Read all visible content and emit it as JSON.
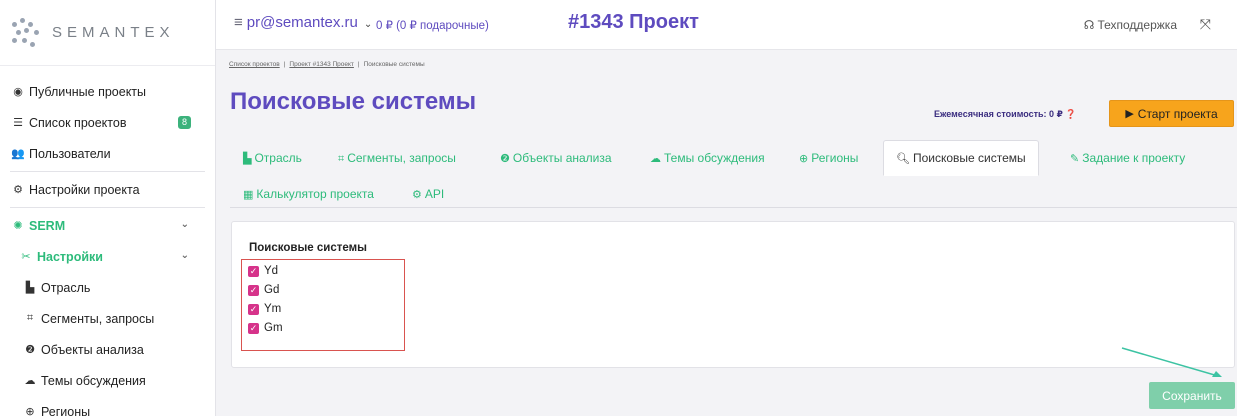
{
  "brand": {
    "logo_text": "SEMANTEX"
  },
  "sidebar": {
    "items": [
      {
        "icon": "eye-icon",
        "label": "Публичные проекты"
      },
      {
        "icon": "list-icon",
        "label": "Список проектов",
        "badge": "8"
      },
      {
        "icon": "users-icon",
        "label": "Пользователи"
      },
      {
        "icon": "settings-icon",
        "label": "Настройки проекта"
      },
      {
        "icon": "serm-icon",
        "label": "SERM"
      },
      {
        "icon": "tools-icon",
        "label": "Настройки"
      },
      {
        "icon": "industry-icon",
        "label": "Отрасль"
      },
      {
        "icon": "segments-icon",
        "label": "Сегменты, запросы"
      },
      {
        "icon": "objects-icon",
        "label": "Объекты анализа"
      },
      {
        "icon": "discussion-icon",
        "label": "Темы обсуждения"
      },
      {
        "icon": "globe-icon",
        "label": "Регионы"
      }
    ]
  },
  "topbar": {
    "user": "pr@semantex.ru",
    "balance": "0 ₽ (0 ₽ подарочные)",
    "project_title": "#1343 Проект",
    "support": "Техподдержка"
  },
  "breadcrumb": {
    "items": [
      "Список проектов",
      "Проект #1343 Проект",
      "Поисковые системы"
    ]
  },
  "page": {
    "title": "Поисковые системы",
    "monthly_cost": "Ежемесячная стоимость: 0 ₽",
    "start_button": "Старт проекта"
  },
  "tabs": [
    {
      "icon": "industry-icon",
      "label": "Отрасль"
    },
    {
      "icon": "segments-icon",
      "label": "Сегменты, запросы"
    },
    {
      "icon": "objects-icon",
      "label": "Объекты анализа"
    },
    {
      "icon": "discussion-icon",
      "label": "Темы обсуждения"
    },
    {
      "icon": "globe-icon",
      "label": "Регионы"
    },
    {
      "icon": "search-icon",
      "label": "Поисковые системы",
      "active": true
    },
    {
      "icon": "user-edit-icon",
      "label": "Задание к проекту"
    },
    {
      "icon": "calculator-icon",
      "label": "Калькулятор проекта"
    },
    {
      "icon": "gear-icon",
      "label": "API"
    }
  ],
  "panel": {
    "title": "Поисковые системы",
    "engines": [
      {
        "label": "Yd",
        "checked": true
      },
      {
        "label": "Gd",
        "checked": true
      },
      {
        "label": "Ym",
        "checked": true
      },
      {
        "label": "Gm",
        "checked": true
      }
    ]
  },
  "actions": {
    "save": "Сохранить"
  },
  "colors": {
    "accent": "#5e4bbf",
    "green": "#2dbb7b",
    "orange": "#f7a41c",
    "checkbox": "#d6338a",
    "annotation_red": "#d9534f"
  }
}
